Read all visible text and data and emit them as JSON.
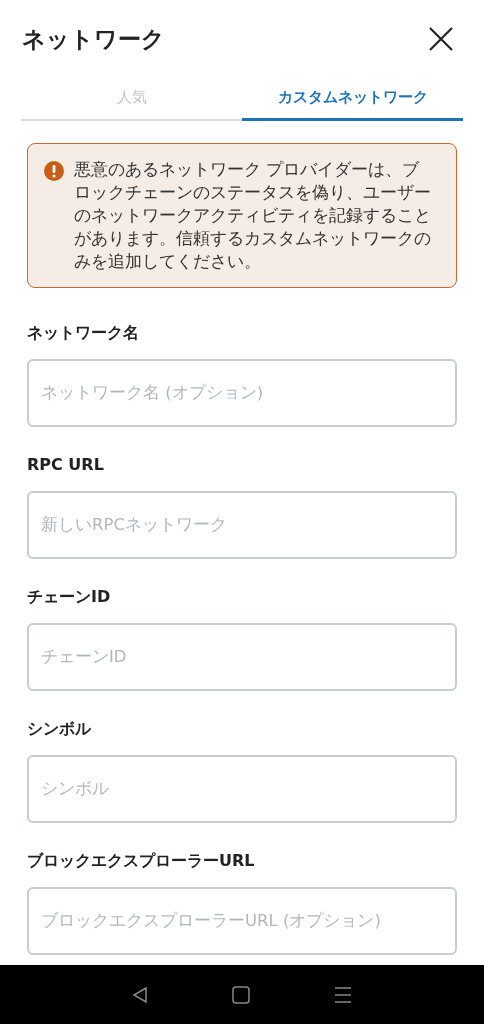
{
  "header": {
    "title": "ネットワーク"
  },
  "tabs": [
    {
      "label": "人気",
      "selected": false
    },
    {
      "label": "カスタムネットワーク",
      "selected": true
    }
  ],
  "warning": {
    "text": "悪意のあるネットワーク プロバイダーは、ブロックチェーンのステータスを偽り、ユーザーのネットワークアクティビティを記録することがあります。信頼するカスタムネットワークのみを追加してください。"
  },
  "fields": [
    {
      "label": "ネットワーク名",
      "placeholder": "ネットワーク名 (オプション)"
    },
    {
      "label": "RPC URL",
      "placeholder": "新しいRPCネットワーク"
    },
    {
      "label": "チェーンID",
      "placeholder": "チェーンID"
    },
    {
      "label": "シンボル",
      "placeholder": "シンボル"
    },
    {
      "label": "ブロックエクスプローラーURL",
      "placeholder": "ブロックエクスプローラーURL (オプション)"
    }
  ]
}
